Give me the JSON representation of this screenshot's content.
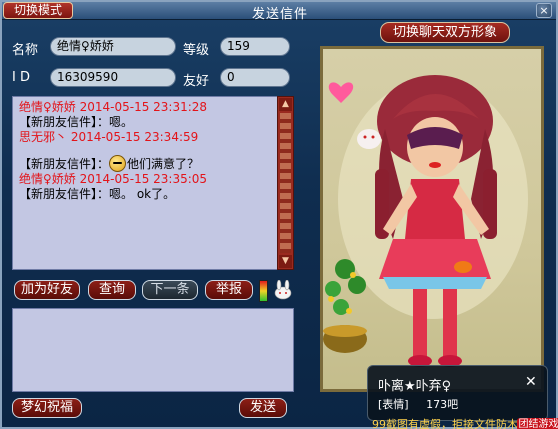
{
  "window": {
    "title": "发送信件",
    "mode_button": "切换模式",
    "close_label": "×"
  },
  "info": {
    "name_label": "名称",
    "name_value": "绝情♀娇娇",
    "level_label": "等级",
    "level_value": "159",
    "id_label": "I  D",
    "id_value": "16309590",
    "friendship_label": "友好",
    "friendship_value": "0"
  },
  "chat": {
    "messages": [
      {
        "head": "绝情♀娇娇  2014-05-15  23:31:28",
        "body": "【新朋友信件】：嗯。"
      },
      {
        "head": "思无邪丶  2014-05-15  23:34:59",
        "body": ""
      },
      {
        "head": "",
        "body": "【新朋友信件】：他们满意了？"
      },
      {
        "head": "绝情♀娇娇  2014-05-15  23:35:05",
        "body": "【新朋友信件】：嗯。 ok了。"
      }
    ]
  },
  "buttons": {
    "add_friend": "加为好友",
    "inquire": "查询",
    "next": "下一条",
    "report": "举报",
    "blessing": "梦幻祝福",
    "send": "发送"
  },
  "avatar": {
    "switch_button": "切换聊天双方形象"
  },
  "tooltip": {
    "name": "卟离★卟弃♀",
    "close": "✕",
    "label": "[表情]",
    "value": "173吧"
  },
  "notice": {
    "text": "99截图有虚假，拒接文件防木马",
    "badge": "团结游戏"
  },
  "colors": {
    "window_bg": "#0f2d4f",
    "red_button": "#8c1f16",
    "chat_bg": "#c3c7e3",
    "timestamp_red": "#e3141a"
  }
}
